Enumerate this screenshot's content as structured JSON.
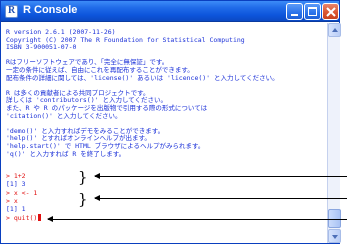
{
  "window": {
    "title": "R Console",
    "app_icon_letter": "R"
  },
  "console": {
    "output_lines": [
      "R version 2.6.1 (2007-11-26)",
      "Copyright (C) 2007 The R Foundation for Statistical Computing",
      "ISBN 3-900051-07-0",
      "",
      "Rはフリーソフトウェアであり、「完全に無保証」です。",
      "一定の条件に従えば、自由にこれを再配布することができます。",
      "配布条件の詳細に関しては、'license()' あるいは 'licence()' と入力してください。",
      "",
      "R は多くの貢献者による共同プロジェクトです。",
      "詳しくは 'contributors()' と入力してください。",
      "また、R や R のパッケージを出版物で引用する際の形式については",
      "'citation()' と入力してください。",
      "",
      "'demo()' と入力すればデモをみることができます。",
      "'help()' とすればオンラインヘルプが出ます。",
      "'help.start()' で HTML ブラウザによるヘルプがみられます。",
      "'q()' と入力すれば R を終了します。"
    ],
    "session": [
      {
        "text": "> 1+2",
        "kind": "input"
      },
      {
        "text": "[1] 3",
        "kind": "output"
      },
      {
        "text": "> x <- 1",
        "kind": "input"
      },
      {
        "text": "> x",
        "kind": "input"
      },
      {
        "text": "[1] 1",
        "kind": "output"
      },
      {
        "text": "> quit()",
        "kind": "input"
      }
    ]
  },
  "colors": {
    "output_text": "#1a30d8",
    "input_text": "#e01010",
    "titlebar": "#0d55dc"
  }
}
